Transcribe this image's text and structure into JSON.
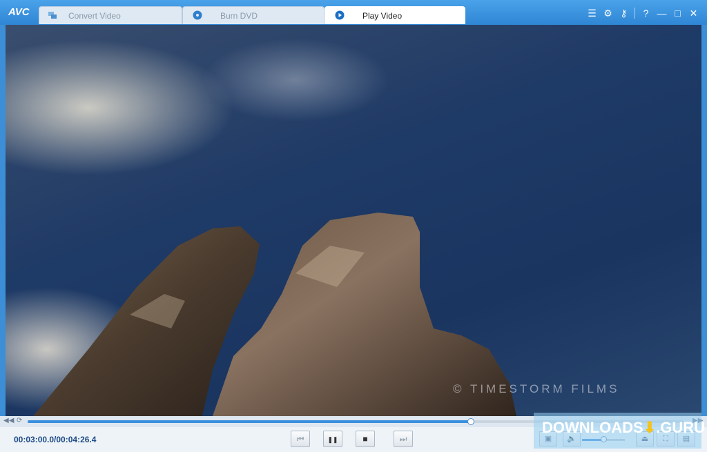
{
  "app": {
    "logo": "AVC"
  },
  "tabs": [
    {
      "label": "Convert Video",
      "icon": "convert-icon",
      "active": false
    },
    {
      "label": "Burn DVD",
      "icon": "disc-icon",
      "active": false
    },
    {
      "label": "Play Video",
      "icon": "play-circle-icon",
      "active": true
    }
  ],
  "titlebar_icons": [
    "list-icon",
    "gear-icon",
    "key-icon",
    "help-icon",
    "minimize-icon",
    "maximize-icon",
    "close-icon"
  ],
  "titlebar_glyphs": {
    "list": "☰",
    "gear": "⚙",
    "key": "⚷",
    "help": "?",
    "minimize": "—",
    "maximize": "□",
    "close": "✕"
  },
  "video": {
    "watermark": "© TIMESTORM FILMS"
  },
  "playback": {
    "timecode": "00:03:00.0/00:04:26.4",
    "progress": 0.676,
    "volume": 0.5
  },
  "controls": {
    "prev": "⏮",
    "pause": "❚❚",
    "stop": "■",
    "next": "⏭"
  },
  "overlay": {
    "brand_left": "DOWNLOADS",
    "brand_right": ".GURU"
  },
  "colors": {
    "accent": "#3b8fdd",
    "titlebar": "#3a92df",
    "timecode": "#1b4a86"
  }
}
